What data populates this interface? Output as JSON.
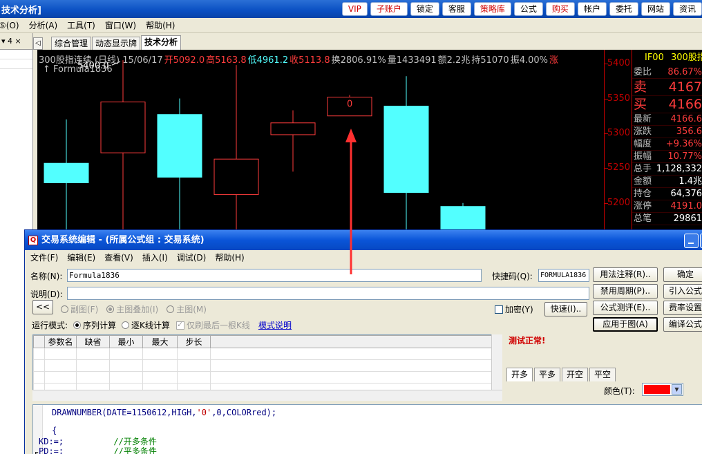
{
  "app": {
    "title": "技术分析]",
    "top_buttons": [
      {
        "label": "VIP",
        "color": "red"
      },
      {
        "label": "子账户",
        "color": "red"
      },
      {
        "label": "锁定",
        "color": "black"
      },
      {
        "label": "客服",
        "color": "black"
      },
      {
        "label": "策略库",
        "color": "red"
      },
      {
        "label": "公式",
        "color": "black"
      },
      {
        "label": "购买",
        "color": "red"
      },
      {
        "label": "帐户",
        "color": "black"
      },
      {
        "label": "委托",
        "color": "black"
      },
      {
        "label": "网站",
        "color": "black"
      },
      {
        "label": "资讯",
        "color": "black"
      }
    ]
  },
  "menu": [
    "⑤(O)",
    "分析(A)",
    "工具(T)",
    "窗口(W)",
    "帮助(H)"
  ],
  "left_panel": {
    "head": "▾ 4 ×"
  },
  "tabs": {
    "nav": "◁",
    "items": [
      "综合管理",
      "动态显示牌",
      "技术分析"
    ],
    "active": 2
  },
  "chart": {
    "info": [
      {
        "text": "300股指连续 (日线) 15/06/17",
        "color": "#c0c0c0"
      },
      {
        "text": "开5092.0",
        "color": "#ff3c3c"
      },
      {
        "text": "高5163.8",
        "color": "#ff3c3c"
      },
      {
        "text": "低4961.2",
        "color": "#52ffff"
      },
      {
        "text": "收5113.8",
        "color": "#ff3c3c"
      },
      {
        "text": "换2806.91%",
        "color": "#c0c0c0"
      },
      {
        "text": "量1433491",
        "color": "#c0c0c0"
      },
      {
        "text": "额2.2兆",
        "color": "#c0c0c0"
      },
      {
        "text": "持51070",
        "color": "#c0c0c0"
      },
      {
        "text": "振4.00%",
        "color": "#c0c0c0"
      },
      {
        "text": "涨",
        "color": "#ff3c3c"
      }
    ],
    "formula_label": "↑ Formula1836",
    "peak_label": "5400.0",
    "marker_label": "0"
  },
  "chart_data": {
    "type": "candlestick",
    "title": "300股指连续 (日线)",
    "ylim": [
      5160,
      5420
    ],
    "yticks": [
      5400,
      5350,
      5300,
      5250,
      5200
    ],
    "candles": [
      {
        "open": 5257,
        "close": 5229,
        "high": 5320,
        "low": 5160,
        "dir": "down"
      },
      {
        "open": 5272,
        "close": 5345,
        "high": 5405,
        "low": 5160,
        "dir": "up"
      },
      {
        "open": 5327,
        "close": 5237,
        "high": 5350,
        "low": 5160,
        "dir": "down"
      },
      {
        "open": 5212,
        "close": 5263,
        "high": 5398,
        "low": 5160,
        "dir": "up"
      },
      {
        "open": 5298,
        "close": 5315,
        "high": 5333,
        "low": 5245,
        "dir": "up"
      },
      {
        "open": 5325,
        "close": 5352,
        "high": 5355,
        "low": 5325,
        "dir": "up"
      },
      {
        "open": 5339,
        "close": 5215,
        "high": 5382,
        "low": 5160,
        "dir": "down"
      },
      {
        "open": 5195,
        "close": 5160,
        "high": 5200,
        "low": 5160,
        "dir": "down"
      }
    ],
    "peak_value": 5400.0,
    "marker_candle": 5
  },
  "quote": {
    "head_code": "IF00",
    "head_name": "300股指",
    "rows": [
      {
        "label": "委比",
        "value": "86.67%",
        "color": "#ff3c3c",
        "big": false
      },
      {
        "label": "卖",
        "value": "4167",
        "color": "#ff3c3c",
        "big": true,
        "labelcolor": "#ff3c3c"
      },
      {
        "label": "买",
        "value": "4166",
        "color": "#ff3c3c",
        "big": true,
        "labelcolor": "#ff3c3c"
      },
      {
        "label": "最新",
        "value": "4166.6",
        "color": "#ff3c3c",
        "big": false
      },
      {
        "label": "涨跌",
        "value": "356.6",
        "color": "#ff3c3c",
        "big": false
      },
      {
        "label": "幅度",
        "value": "+9.36%",
        "color": "#ff3c3c",
        "big": false
      },
      {
        "label": "振幅",
        "value": "10.77%",
        "color": "#ff3c3c",
        "big": false
      },
      {
        "label": "总手",
        "value": "1,128,332",
        "color": "#ffffff",
        "big": false
      },
      {
        "label": "金额",
        "value": "1.4兆",
        "color": "#ffffff",
        "big": false
      },
      {
        "label": "持仓",
        "value": "64,376",
        "color": "#ffffff",
        "big": false
      },
      {
        "label": "涨停",
        "value": "4191.0",
        "color": "#ff3c3c",
        "big": false
      },
      {
        "label": "总笔",
        "value": "29861",
        "color": "#ffffff",
        "big": false
      }
    ]
  },
  "dialog": {
    "title": "交易系统编辑 - (所属公式组 : 交易系统)",
    "icon": "Q",
    "menu": [
      "文件(F)",
      "编辑(E)",
      "查看(V)",
      "插入(I)",
      "调试(D)",
      "帮助(H)"
    ],
    "name_label": "名称(N):",
    "name_value": "Formula1836",
    "shortcut_label": "快捷码(Q):",
    "shortcut_value": "FORMULA1836",
    "desc_label": "说明(D):",
    "desc_value": "",
    "collapse_btn": "<<",
    "display_modes": [
      {
        "label": "副图(F)",
        "on": false
      },
      {
        "label": "主图叠加(I)",
        "on": true
      },
      {
        "label": "主图(M)",
        "on": false
      }
    ],
    "encrypt_label": "加密(Y)",
    "fast_btn": "快速(I)..",
    "run_mode_label": "运行模式:",
    "run_modes": [
      {
        "label": "序列计算",
        "on": true
      },
      {
        "label": "逐K线计算",
        "on": false
      }
    ],
    "last_kline_label": "仅刷最后一根K线",
    "mode_link": "模式说明",
    "buttons_col1": [
      "用法注释(R)..",
      "禁用周期(P)..",
      "公式测评(E)..",
      "应用于图(A)"
    ],
    "buttons_col2": [
      "确定",
      "引入公式",
      "费率设置",
      "编译公式"
    ],
    "test_status": "测试正常!",
    "param_headers": [
      "参数名",
      "缺省",
      "最小",
      "最大",
      "步长"
    ],
    "signal_tabs": [
      "开多",
      "平多",
      "开空",
      "平空"
    ],
    "color_label": "颜色(T):",
    "color_value": "#ff0000",
    "code_lines": [
      {
        "parts": [
          {
            "t": "DRAWNUMBER(DATE=1150612,HIGH,",
            "c": "kw"
          },
          {
            "t": "'0'",
            "c": "str"
          },
          {
            "t": ",0,COLORred);",
            "c": "kw"
          }
        ]
      },
      {
        "parts": [
          {
            "t": "",
            "c": "kw"
          }
        ]
      },
      {
        "parts": [
          {
            "t": "{",
            "c": "kw"
          }
        ]
      },
      {
        "parts": [
          {
            "t": "KD:=;          ",
            "c": "kw"
          },
          {
            "t": "//开多条件",
            "c": "cm"
          }
        ]
      },
      {
        "parts": [
          {
            "t": "PD:=;          ",
            "c": "kw"
          },
          {
            "t": "//平多条件",
            "c": "cm"
          }
        ]
      }
    ],
    "gutter_number": "5"
  }
}
